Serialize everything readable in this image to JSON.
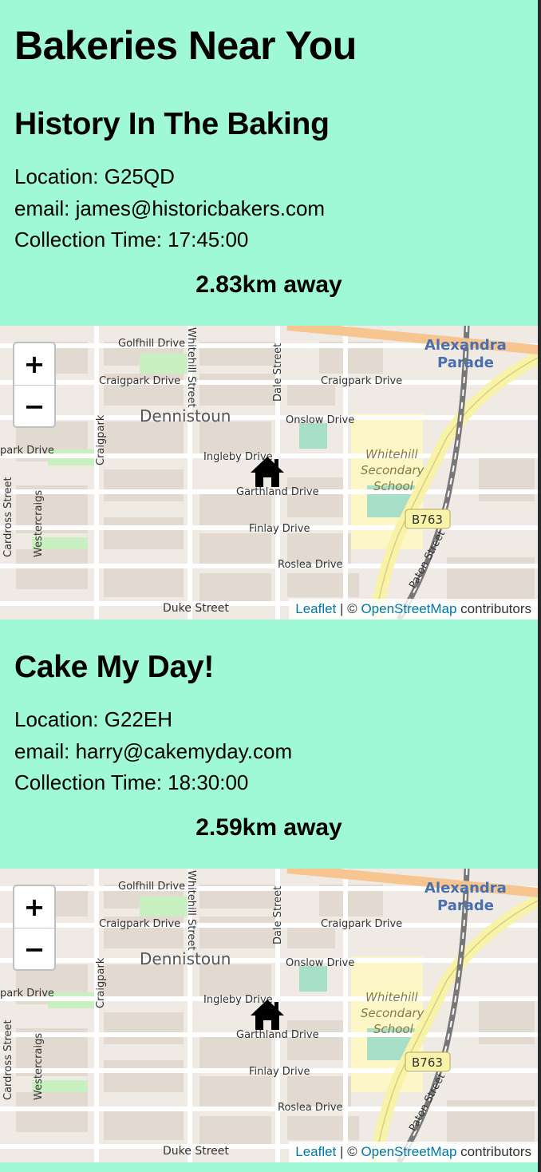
{
  "page": {
    "title": "Bakeries Near You"
  },
  "bakeries": [
    {
      "name": "History In The Baking",
      "location_label": "Location: G25QD",
      "email_label": "email: james@historicbakers.com",
      "collection_label": "Collection Time: 17:45:00",
      "distance": "2.83km away"
    },
    {
      "name": "Cake My Day!",
      "location_label": "Location: G22EH",
      "email_label": "email: harry@cakemyday.com",
      "collection_label": "Collection Time: 18:30:00",
      "distance": "2.59km away"
    }
  ],
  "map": {
    "zoom_in": "+",
    "zoom_out": "−",
    "marker_icon": "home-icon",
    "attribution": {
      "leaflet": "Leaflet",
      "separator": " | © ",
      "osm": "OpenStreetMap",
      "suffix": " contributors"
    },
    "labels": {
      "alexandra": "Alexandra",
      "parade": "Parade",
      "golfhill": "Golfhill Drive",
      "craigpark_drive_left": "Craigpark Drive",
      "craigpark_drive_right": "Craigpark Drive",
      "dennistoun": "Dennistoun",
      "onslow": "Onslow Drive",
      "ingleby": "Ingleby Drive",
      "garthland": "Garthland Drive",
      "finlay": "Finlay Drive",
      "roslea": "Roslea Drive",
      "duke": "Duke Street",
      "whitehill1": "Whitehill",
      "whitehill2": "Secondary",
      "whitehill3": "School",
      "b763": "B763",
      "paton": "Paton Street",
      "craigpark_vert": "Craigpark",
      "westercraigs": "Westercraigs",
      "cardross": "Cardross Street",
      "whitehill_street": "Whitehill Street",
      "dale_street": "Dale Street",
      "park_drive": "park Drive"
    },
    "colors": {
      "land": "#efeae3",
      "block": "#d8cdc3",
      "road": "#ffffff",
      "major_road": "#f8f3a8",
      "park": "#c8f0c0",
      "school": "#fdf7c8",
      "water": "#a8dfc8",
      "rail": "#777777"
    }
  }
}
